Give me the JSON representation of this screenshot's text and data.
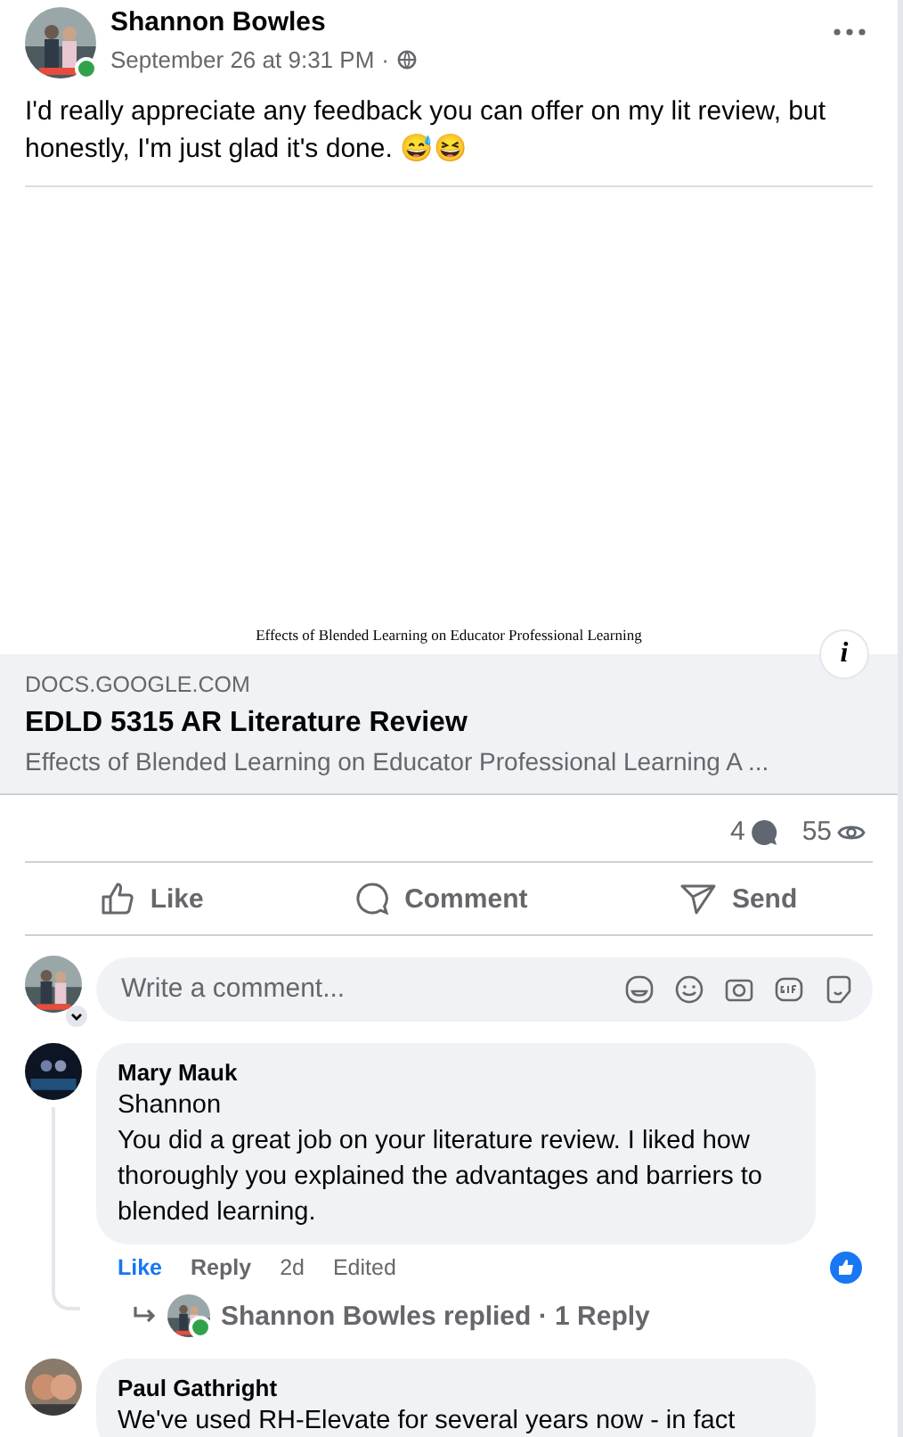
{
  "post": {
    "author": "Shannon Bowles",
    "online": true,
    "time": "September 26 at 9:31 PM",
    "separator": "·",
    "text": "I'd really appreciate any feedback you can offer on my lit review, but honestly, I'm just glad it's done. 😅😆"
  },
  "link_preview": {
    "doc_caption": "Effects of Blended Learning on Educator Professional Learning",
    "info": "i",
    "domain": "DOCS.GOOGLE.COM",
    "title": "EDLD 5315 AR Literature Review",
    "description": "Effects of Blended Learning on Educator Professional Learning A ..."
  },
  "stats": {
    "comments": "4",
    "views": "55"
  },
  "actions": [
    {
      "kind": "like",
      "label": "Like"
    },
    {
      "kind": "comment",
      "label": "Comment"
    },
    {
      "kind": "send",
      "label": "Send"
    }
  ],
  "comment_box": {
    "placeholder": "Write a comment..."
  },
  "comments": [
    {
      "author": "Mary Mauk",
      "lines": [
        "Shannon",
        "You did a great job on your literature review. I liked how thoroughly you explained the advantages and barriers to blended learning."
      ],
      "liked": true,
      "like": "Like",
      "reply": "Reply",
      "age": "2d",
      "edited": "Edited",
      "has_reaction": true,
      "replies": {
        "author": "Shannon Bowles replied",
        "separator": "·",
        "count": "1 Reply",
        "online": true
      }
    },
    {
      "author": "Paul Gathright",
      "lines": [
        "We've used RH-Elevate for several years now - in fact"
      ]
    }
  ]
}
